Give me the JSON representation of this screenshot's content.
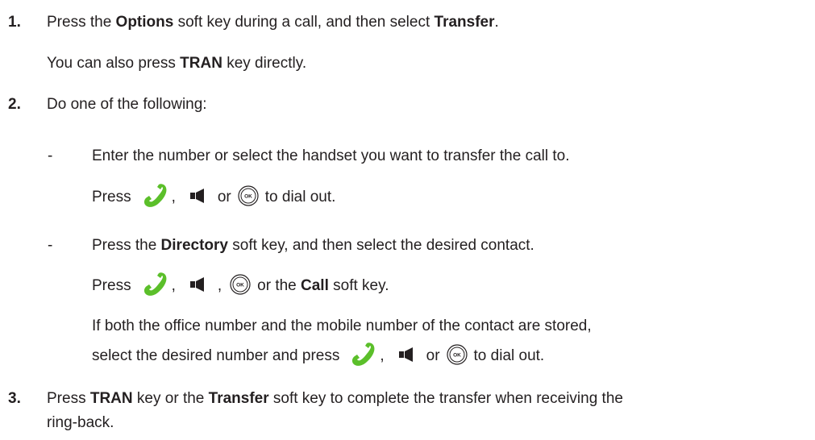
{
  "steps": {
    "s1": {
      "num": "1.",
      "pre": "Press the ",
      "options": "Options",
      "mid": " soft key during a call, and then select ",
      "transfer": "Transfer",
      "post": ".",
      "note_pre": "You can also press ",
      "note_tran": "TRAN",
      "note_post": " key directly."
    },
    "s2": {
      "num": "2.",
      "text": "Do one of the following:",
      "dash": "-",
      "a_text": "Enter the number or select the handset you want to transfer the call to.",
      "a_press": "Press",
      "a_comma": ",",
      "a_or": "or",
      "a_post": "to dial out.",
      "b_pre": "Press the ",
      "b_directory": "Directory",
      "b_post": " soft key, and then select the desired contact.",
      "b_press": "Press",
      "b_comma1": ",",
      "b_comma2": ",",
      "b_or": "or the ",
      "b_call": "Call",
      "b_post2": " soft key.",
      "b_if": "If both the office number and the mobile number of the contact are stored,",
      "b_select": "select the desired number and press",
      "b_comma3": ",",
      "b_or2": "or",
      "b_post3": "to dial out."
    },
    "s3": {
      "num": "3.",
      "pre": "Press ",
      "tran": "TRAN",
      "mid": " key or the ",
      "transfer": "Transfer",
      "post": " soft key to complete the transfer when receiving the",
      "cont": "ring-back."
    }
  },
  "icons": {
    "handset": "handset-icon",
    "speaker": "speakerphone-icon",
    "ok": "ok-key-icon",
    "handset_color": "#5bbf2a",
    "speaker_color": "#231f20"
  }
}
